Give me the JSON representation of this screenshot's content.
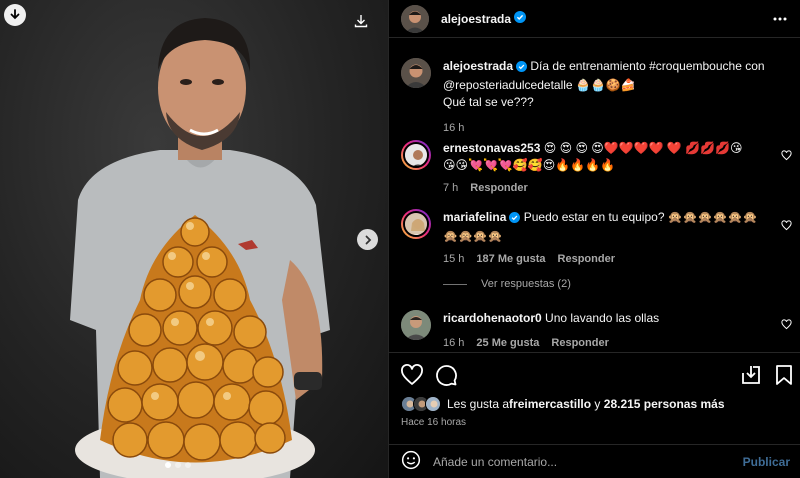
{
  "post": {
    "username": "alejoestrada",
    "caption_line1": "Día de entrenamiento #croquembouche con",
    "caption_line2": "@reposteriadulcedetalle 🧁🧁🍪🍰",
    "caption_line3": "Qué tal se ve???",
    "caption_time": "16 h"
  },
  "comments": [
    {
      "username": "ernestonavas253",
      "text_line1": "😍 😍 😍 😍❤️❤️❤️❤️ ❤️ 💋💋💋😘",
      "text_line2": "😘😘💘💘💘🥰🥰😍🔥🔥🔥🔥",
      "time": "7 h",
      "likes": "",
      "reply": "Responder"
    },
    {
      "username": "mariafelina",
      "text_line1": "Puedo estar en tu equipo? 🙊🙊🙊🙊🙊🙊",
      "text_line2": "🙊🙊🙊🙊",
      "time": "15 h",
      "likes": "187 Me gusta",
      "reply": "Responder"
    },
    {
      "username": "ricardohenaotor0",
      "text_line1": "Uno lavando las ollas",
      "text_line2": "",
      "time": "16 h",
      "likes": "25 Me gusta",
      "reply": "Responder"
    }
  ],
  "view_replies": "Ver respuestas (2)",
  "likes_prefix": "Les gusta a ",
  "likes_user": "freimercastillo",
  "likes_mid": " y ",
  "likes_count": "28.215 personas más",
  "timestamp": "Hace 16 horas",
  "add_comment": {
    "placeholder": "Añade un comentario...",
    "publish": "Publicar"
  },
  "colors": {
    "background": "#000000",
    "verified": "#0095f6",
    "publish_disabled": "#3f6d97",
    "muted_text": "#a8a8a8"
  },
  "icons": [
    "download-icon",
    "next-arrow-icon",
    "more-options-icon",
    "verified-icon",
    "heart-icon",
    "comment-icon",
    "share-icon",
    "save-icon",
    "emoji-icon"
  ]
}
